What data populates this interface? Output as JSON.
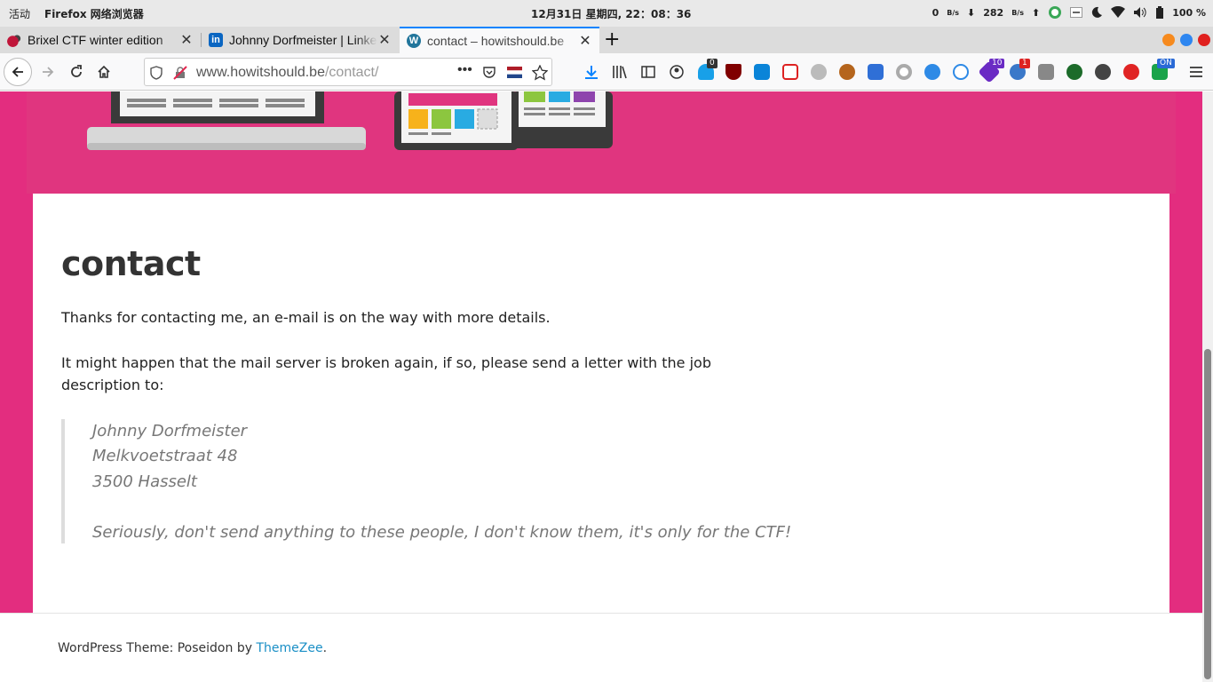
{
  "topbar": {
    "activities": "活动",
    "app_name": "Firefox 网络浏览器",
    "clock": "12月31日 星期四, 22：08：36",
    "net_down_value": "0",
    "net_down_unit": "B/s",
    "net_up_value": "282",
    "net_up_unit": "B/s",
    "battery": "100 %"
  },
  "tabs": [
    {
      "title": "Brixel CTF winter edition",
      "favicon": "brixel-icon",
      "active": false
    },
    {
      "title": "Johnny Dorfmeister | LinkedIn",
      "favicon": "linkedin-icon",
      "active": false
    },
    {
      "title": "contact – howitshould.be",
      "favicon": "wordpress-icon",
      "active": true
    }
  ],
  "navbar": {
    "url_host": "www.howitshould.be",
    "url_path": "/contact/",
    "ext_badges": {
      "ghostery": "0",
      "screenshot": "10",
      "notif": "1",
      "toggle": "ON"
    }
  },
  "colors": {
    "accent": "#0a84ff",
    "page_pink": "#e32d7f",
    "link": "#1a8fc6"
  },
  "page": {
    "title": "contact",
    "para1": "Thanks for contacting me, an e-mail is on the way with more details.",
    "para2": "It might happen that the mail server is broken again, if so, please send a letter with the job description to:",
    "quote": {
      "line1": "Johnny Dorfmeister",
      "line2": "Melkvoetstraat 48",
      "line3": "3500 Hasselt",
      "line4": "Seriously, don't send anything to these people, I don't know them, it's only for the CTF!"
    }
  },
  "footer": {
    "prefix": "WordPress Theme: Poseidon by ",
    "link": "ThemeZee",
    "suffix": "."
  }
}
